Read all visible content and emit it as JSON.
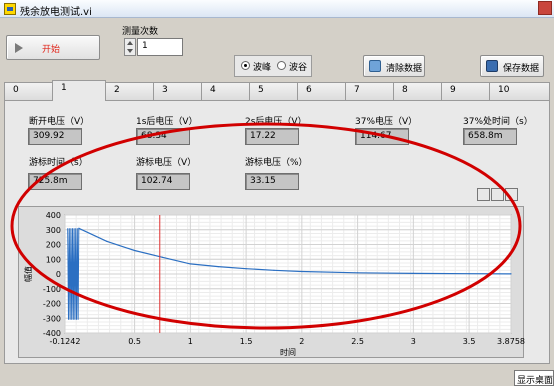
{
  "window": {
    "title": "残余放电测试.vi"
  },
  "toolbar": {
    "start_label": "开始",
    "count_label": "测量次数",
    "count_value": "1",
    "radio": {
      "options": [
        "波峰",
        "波谷"
      ],
      "selected": "波峰"
    },
    "clear_label": "清除数据",
    "save_label": "保存数据"
  },
  "tabs": {
    "items": [
      "0",
      "1",
      "2",
      "3",
      "4",
      "5",
      "6",
      "7",
      "8",
      "9",
      "10"
    ],
    "active": "1"
  },
  "indicators": {
    "row1": [
      {
        "label": "断开电压（V）",
        "value": "309.92"
      },
      {
        "label": "1s后电压（V）",
        "value": "68.34"
      },
      {
        "label": "2s后电压（V）",
        "value": "17.22"
      },
      {
        "label": "37%电压（V）",
        "value": "114.67"
      },
      {
        "label": "37%处时间（s）",
        "value": "658.8m"
      }
    ],
    "row2": [
      {
        "label": "游标时间（s）",
        "value": "725.8m"
      },
      {
        "label": "游标电压（V）",
        "value": "102.74"
      },
      {
        "label": "游标电压（%）",
        "value": "33.15"
      }
    ]
  },
  "graph": {
    "ylabel": "幅值",
    "xlabel": "时间"
  },
  "chart_data": {
    "type": "line",
    "title": "",
    "xlabel": "时间",
    "ylabel": "幅值",
    "xlim": [
      -0.1242,
      3.8758
    ],
    "ylim": [
      -400,
      400
    ],
    "x_ticks": [
      "-0.1242",
      "0.5",
      "1",
      "1.5",
      "2",
      "2.5",
      "3",
      "3.5",
      "3.8758"
    ],
    "y_ticks": [
      "400",
      "300",
      "200",
      "100",
      "0",
      "-100",
      "-200",
      "-300",
      "-400"
    ],
    "grid": true,
    "cursor_x": 0.7258,
    "series": [
      {
        "color": "#2b6fc2",
        "oscillation": {
          "x_start": -0.1,
          "x_end": 0.0,
          "amplitude": 309.92
        },
        "points": [
          [
            0.0,
            309.92
          ],
          [
            0.25,
            222
          ],
          [
            0.5,
            159
          ],
          [
            0.75,
            113
          ],
          [
            1.0,
            68.34
          ],
          [
            1.25,
            50
          ],
          [
            1.5,
            36
          ],
          [
            1.75,
            25
          ],
          [
            2.0,
            17.22
          ],
          [
            2.5,
            8
          ],
          [
            3.0,
            4
          ],
          [
            3.5,
            2
          ],
          [
            3.8758,
            1
          ]
        ]
      }
    ]
  },
  "taskbar": {
    "desktop_tip": "显示桌面"
  },
  "colors": {
    "cursor": "#e03030",
    "annotation": "#d10000",
    "start_text": "#e1261c"
  },
  "icons": [
    "vi-icon",
    "play-icon",
    "spin-up-icon",
    "spin-down-icon",
    "clear-data-icon",
    "save-data-icon",
    "zoom-tool-icon",
    "pan-tool-icon",
    "cursor-tool-icon"
  ]
}
